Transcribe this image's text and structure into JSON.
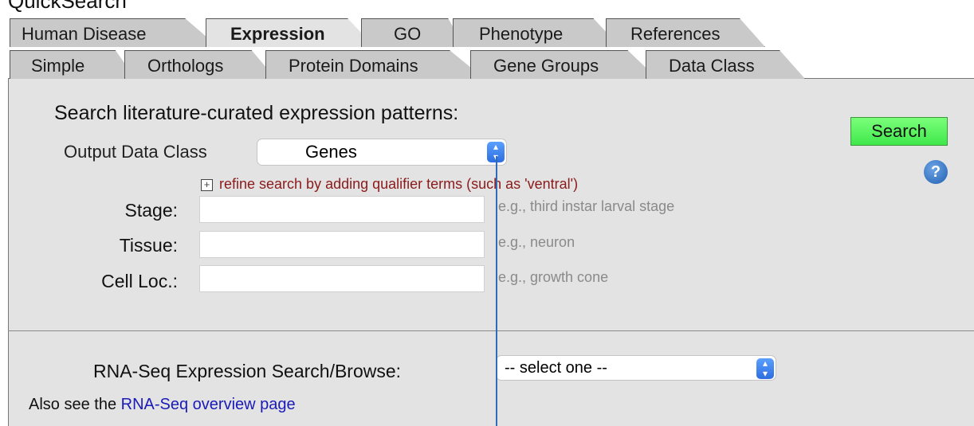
{
  "page": {
    "title": "QuickSearch"
  },
  "tabs_row1": [
    {
      "label": "Human Disease",
      "active": false
    },
    {
      "label": "Expression",
      "active": true
    },
    {
      "label": "GO",
      "active": false
    },
    {
      "label": "Phenotype",
      "active": false
    },
    {
      "label": "References",
      "active": false
    }
  ],
  "tabs_row2": [
    {
      "label": "Simple",
      "active": false
    },
    {
      "label": "Orthologs",
      "active": false
    },
    {
      "label": "Protein Domains",
      "active": false
    },
    {
      "label": "Gene Groups",
      "active": false
    },
    {
      "label": "Data Class",
      "active": false
    }
  ],
  "main": {
    "heading": "Search literature-curated expression patterns:",
    "output_label": "Output Data Class",
    "output_value": "Genes",
    "refine_text": "refine search by adding qualifier terms (such as 'ventral')",
    "search_button": "Search",
    "help_glyph": "?",
    "fields": [
      {
        "label": "Stage:",
        "value": "",
        "hint": "e.g., third instar larval stage"
      },
      {
        "label": "Tissue:",
        "value": "",
        "hint": "e.g., neuron"
      },
      {
        "label": "Cell Loc.:",
        "value": "",
        "hint": "e.g., growth cone"
      }
    ],
    "rnaseq_label": "RNA-Seq Expression Search/Browse:",
    "rnaseq_select": "-- select one --",
    "also_prefix": "Also see the",
    "also_link": "RNA-Seq overview page"
  },
  "colors": {
    "accent_green": "#3fe84b",
    "link_blue": "#1a1ab8",
    "refine_red": "#8b1a1a"
  }
}
